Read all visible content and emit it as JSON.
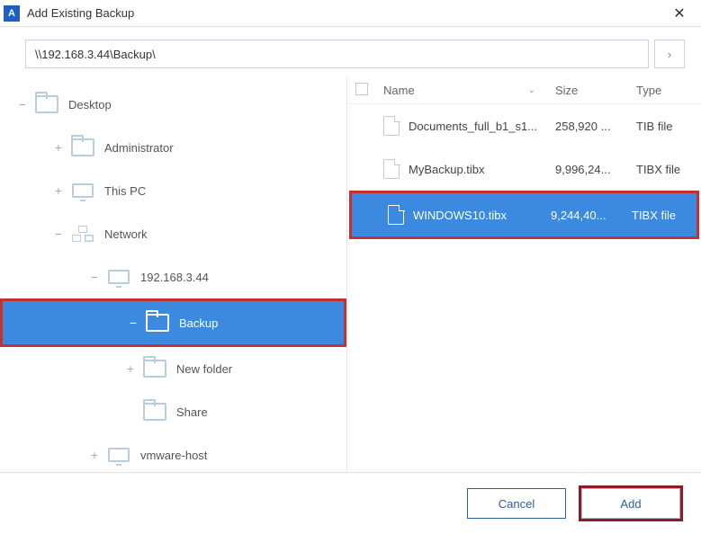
{
  "window": {
    "title": "Add Existing Backup",
    "icon_letter": "A"
  },
  "path": {
    "value": "\\\\192.168.3.44\\Backup\\"
  },
  "tree": {
    "desktop": "Desktop",
    "administrator": "Administrator",
    "this_pc": "This PC",
    "network": "Network",
    "host": "192.168.3.44",
    "backup": "Backup",
    "new_folder": "New folder",
    "share": "Share",
    "vmware": "vmware-host"
  },
  "columns": {
    "name": "Name",
    "size": "Size",
    "type": "Type"
  },
  "files": [
    {
      "name": "Documents_full_b1_s1...",
      "size": "258,920 ...",
      "type": "TIB file"
    },
    {
      "name": "MyBackup.tibx",
      "size": "9,996,24...",
      "type": "TIBX file"
    },
    {
      "name": "WINDOWS10.tibx",
      "size": "9,244,40...",
      "type": "TIBX file"
    }
  ],
  "buttons": {
    "cancel": "Cancel",
    "add": "Add"
  }
}
